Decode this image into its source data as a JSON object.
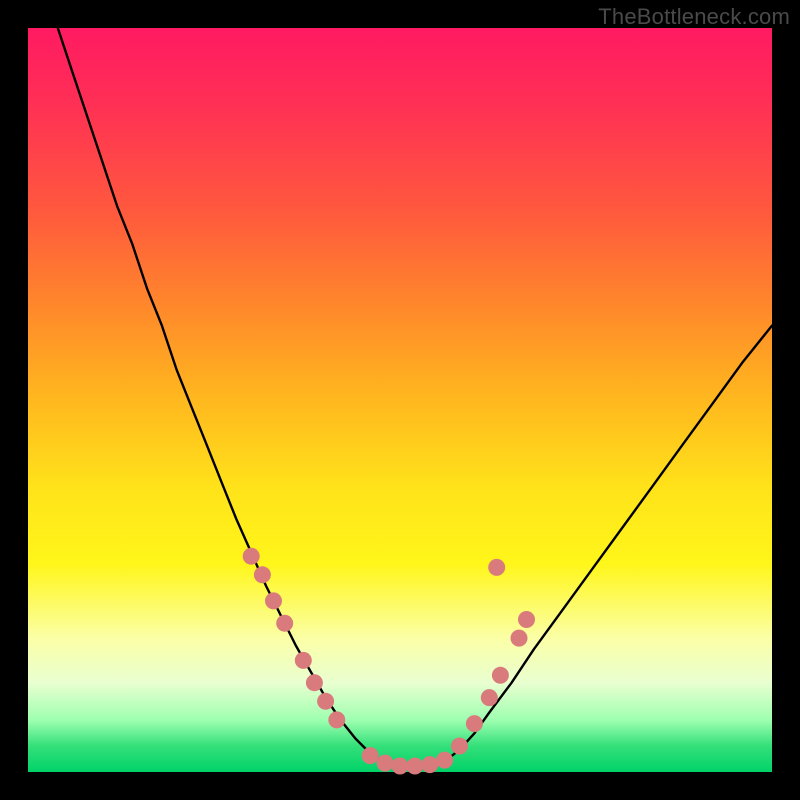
{
  "watermark": "TheBottleneck.com",
  "colors": {
    "curve_stroke": "#000000",
    "dot_fill": "#d97a7d",
    "dot_stroke": "#c45e62"
  },
  "chart_data": {
    "type": "line",
    "title": "",
    "xlabel": "",
    "ylabel": "",
    "xlim": [
      0,
      100
    ],
    "ylim": [
      0,
      100
    ],
    "series": [
      {
        "name": "bottleneck-curve",
        "x": [
          4,
          6,
          8,
          10,
          12,
          14,
          16,
          18,
          20,
          22,
          24,
          26,
          28,
          30,
          32,
          34,
          36,
          38,
          40,
          42,
          44,
          46,
          48,
          50,
          52,
          54,
          56,
          58,
          60,
          62,
          65,
          68,
          72,
          76,
          80,
          84,
          88,
          92,
          96,
          100
        ],
        "y": [
          100,
          94,
          88,
          82,
          76,
          71,
          65,
          60,
          54,
          49,
          44,
          39,
          34,
          29.5,
          25,
          21,
          17,
          13.5,
          10,
          7,
          4.5,
          2.5,
          1.2,
          0.6,
          0.4,
          0.6,
          1.4,
          3,
          5.2,
          8,
          12,
          16.5,
          22,
          27.5,
          33,
          38.5,
          44,
          49.5,
          55,
          60
        ]
      }
    ],
    "annotations": {
      "dots": [
        {
          "x": 30,
          "y": 29
        },
        {
          "x": 31.5,
          "y": 26.5
        },
        {
          "x": 33,
          "y": 23
        },
        {
          "x": 34.5,
          "y": 20
        },
        {
          "x": 37,
          "y": 15
        },
        {
          "x": 38.5,
          "y": 12
        },
        {
          "x": 40,
          "y": 9.5
        },
        {
          "x": 41.5,
          "y": 7
        },
        {
          "x": 46,
          "y": 2.2
        },
        {
          "x": 48,
          "y": 1.2
        },
        {
          "x": 50,
          "y": 0.8
        },
        {
          "x": 52,
          "y": 0.8
        },
        {
          "x": 54,
          "y": 1.0
        },
        {
          "x": 56,
          "y": 1.6
        },
        {
          "x": 58,
          "y": 3.5
        },
        {
          "x": 60,
          "y": 6.5
        },
        {
          "x": 62,
          "y": 10
        },
        {
          "x": 63.5,
          "y": 13
        },
        {
          "x": 66,
          "y": 18
        },
        {
          "x": 67,
          "y": 20.5
        },
        {
          "x": 63,
          "y": 27.5
        }
      ]
    }
  }
}
